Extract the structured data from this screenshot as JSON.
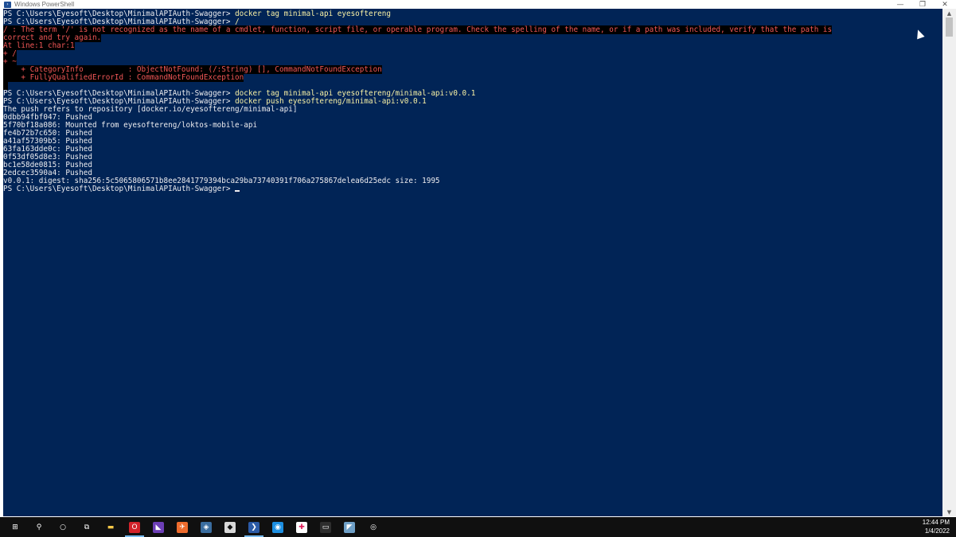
{
  "window": {
    "title": "Windows PowerShell",
    "icon": "powershell-icon",
    "controls": {
      "minimize": "—",
      "restore": "❐",
      "close": "✕"
    }
  },
  "console": {
    "background": "#012456",
    "prompt": "PS C:\\Users\\Eyesoft\\Desktop\\MinimalAPIAuth-Swagger> ",
    "lines": [
      {
        "segments": [
          {
            "text": "PS C:\\Users\\Eyesoft\\Desktop\\MinimalAPIAuth-Swagger> ",
            "style": ""
          },
          {
            "text": "docker tag minimal-api eyesoftereng",
            "style": "cmd"
          }
        ]
      },
      {
        "segments": [
          {
            "text": "PS C:\\Users\\Eyesoft\\Desktop\\MinimalAPIAuth-Swagger> ",
            "style": ""
          },
          {
            "text": "/",
            "style": "cmd"
          }
        ]
      },
      {
        "segments": [
          {
            "text": "/ : The term '/' is not recognized as the name of a cmdlet, function, script file, or operable program. Check the spelling of the name, or if a path was included, verify that the path is",
            "style": "err"
          }
        ]
      },
      {
        "segments": [
          {
            "text": "correct and try again.",
            "style": "err"
          }
        ]
      },
      {
        "segments": [
          {
            "text": "At line:1 char:1",
            "style": "err"
          }
        ]
      },
      {
        "segments": [
          {
            "text": "+ /",
            "style": "err"
          }
        ]
      },
      {
        "segments": [
          {
            "text": "+ ~",
            "style": "err"
          }
        ]
      },
      {
        "segments": [
          {
            "text": "    + CategoryInfo          : ObjectNotFound: (/:String) [], CommandNotFoundException",
            "style": "err"
          }
        ]
      },
      {
        "segments": [
          {
            "text": "    + FullyQualifiedErrorId : CommandNotFoundException",
            "style": "err"
          }
        ]
      },
      {
        "segments": [
          {
            "text": " ",
            "style": "errbg"
          }
        ]
      },
      {
        "segments": [
          {
            "text": "PS C:\\Users\\Eyesoft\\Desktop\\MinimalAPIAuth-Swagger> ",
            "style": ""
          },
          {
            "text": "docker tag minimal-api eyesoftereng/minimal-api:v0.0.1",
            "style": "cmd"
          }
        ]
      },
      {
        "segments": [
          {
            "text": "PS C:\\Users\\Eyesoft\\Desktop\\MinimalAPIAuth-Swagger> ",
            "style": ""
          },
          {
            "text": "docker push eyesoftereng/minimal-api:v0.0.1",
            "style": "cmd"
          }
        ]
      },
      {
        "segments": [
          {
            "text": "The push refers to repository [docker.io/eyesoftereng/minimal-api]",
            "style": ""
          }
        ]
      },
      {
        "segments": [
          {
            "text": "0dbb94fbf047: Pushed",
            "style": ""
          }
        ]
      },
      {
        "segments": [
          {
            "text": "5f70bf18a086: Mounted from eyesoftereng/loktos-mobile-api",
            "style": ""
          }
        ]
      },
      {
        "segments": [
          {
            "text": "fe4b72b7c650: Pushed",
            "style": ""
          }
        ]
      },
      {
        "segments": [
          {
            "text": "a41af57309b5: Pushed",
            "style": ""
          }
        ]
      },
      {
        "segments": [
          {
            "text": "63fa163dde0c: Pushed",
            "style": ""
          }
        ]
      },
      {
        "segments": [
          {
            "text": "0f53df05d8e3: Pushed",
            "style": ""
          }
        ]
      },
      {
        "segments": [
          {
            "text": "bc1e58de0815: Pushed",
            "style": ""
          }
        ]
      },
      {
        "segments": [
          {
            "text": "2edcec3590a4: Pushed",
            "style": ""
          }
        ]
      },
      {
        "segments": [
          {
            "text": "v0.0.1: digest: sha256:5c5065806571b8ee2841779394bca29ba73740391f706a275867delea6d25edc size: 1995",
            "style": ""
          }
        ]
      },
      {
        "segments": [
          {
            "text": "PS C:\\Users\\Eyesoft\\Desktop\\MinimalAPIAuth-Swagger> ",
            "style": ""
          }
        ],
        "cursor": true
      }
    ]
  },
  "scrollbar": {
    "up": "▲",
    "down": "▼"
  },
  "taskbar": {
    "items": [
      {
        "name": "start-button",
        "icon": "windows-icon",
        "glyph": "⊞",
        "color": "#ffffff",
        "bg": "transparent"
      },
      {
        "name": "search-button",
        "icon": "search-icon",
        "glyph": "⚲",
        "color": "#ffffff",
        "bg": "transparent"
      },
      {
        "name": "cortana-button",
        "icon": "cortana-icon",
        "glyph": "○",
        "color": "#ffffff",
        "bg": "transparent"
      },
      {
        "name": "task-view-button",
        "icon": "task-view-icon",
        "glyph": "⧉",
        "color": "#ffffff",
        "bg": "transparent"
      },
      {
        "name": "file-explorer-button",
        "icon": "folder-icon",
        "glyph": "▬",
        "color": "#f7c948",
        "bg": "transparent"
      },
      {
        "name": "opera-button",
        "icon": "opera-icon",
        "glyph": "O",
        "color": "#ffffff",
        "bg": "#d3222a",
        "active": true
      },
      {
        "name": "visual-studio-button",
        "icon": "visual-studio-icon",
        "glyph": "◣",
        "color": "#ffffff",
        "bg": "#6d3fb6"
      },
      {
        "name": "postman-button",
        "icon": "postman-icon",
        "glyph": "✈",
        "color": "#ffffff",
        "bg": "#ef6c2d"
      },
      {
        "name": "app-button-1",
        "icon": "network-app-icon",
        "glyph": "◈",
        "color": "#ffffff",
        "bg": "#3a6d9f"
      },
      {
        "name": "app-button-2",
        "icon": "sourcetree-icon",
        "glyph": "◆",
        "color": "#101010",
        "bg": "#d8d8d8"
      },
      {
        "name": "powershell-button",
        "icon": "powershell-icon",
        "glyph": "❯",
        "color": "#ffffff",
        "bg": "#2b5aa6",
        "active": true
      },
      {
        "name": "docker-button",
        "icon": "docker-icon",
        "glyph": "◉",
        "color": "#ffffff",
        "bg": "#1d8fe1"
      },
      {
        "name": "slack-button",
        "icon": "slack-icon",
        "glyph": "✚",
        "color": "#e01e5a",
        "bg": "#ffffff"
      },
      {
        "name": "terminal-button",
        "icon": "terminal-icon",
        "glyph": "▭",
        "color": "#ffffff",
        "bg": "#2d2d2d"
      },
      {
        "name": "notes-button",
        "icon": "notes-icon",
        "glyph": "◤",
        "color": "#ffffff",
        "bg": "#6fa0c7"
      },
      {
        "name": "app-button-3",
        "icon": "target-icon",
        "glyph": "◎",
        "color": "#ffffff",
        "bg": "transparent"
      }
    ],
    "clock": {
      "time": "12:44 PM",
      "date": "1/4/2022"
    }
  }
}
